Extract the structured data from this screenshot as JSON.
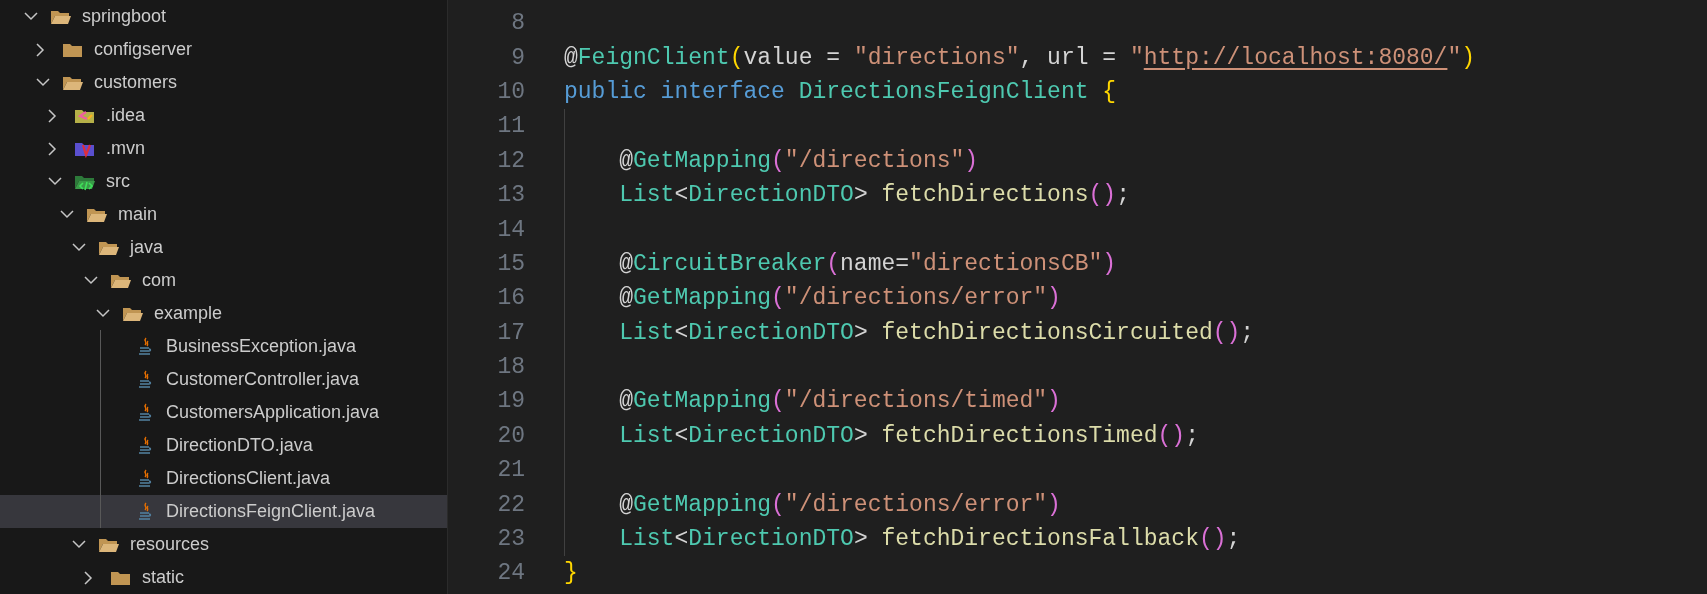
{
  "explorer": {
    "tree": [
      {
        "label": "springboot",
        "kind": "folder",
        "expanded": true,
        "selected": false,
        "children": [
          {
            "label": "configserver",
            "kind": "folder",
            "expanded": false,
            "selected": false
          },
          {
            "label": "customers",
            "kind": "folder",
            "expanded": true,
            "selected": false,
            "children": [
              {
                "label": ".idea",
                "kind": "idea",
                "expanded": false,
                "selected": false
              },
              {
                "label": ".mvn",
                "kind": "mvn",
                "expanded": false,
                "selected": false
              },
              {
                "label": "src",
                "kind": "src",
                "expanded": true,
                "selected": false,
                "children": [
                  {
                    "label": "main",
                    "kind": "folder",
                    "expanded": true,
                    "selected": false,
                    "children": [
                      {
                        "label": "java",
                        "kind": "folder",
                        "expanded": true,
                        "selected": false,
                        "children": [
                          {
                            "label": "com",
                            "kind": "folder",
                            "expanded": true,
                            "selected": false,
                            "children": [
                              {
                                "label": "example",
                                "kind": "folder",
                                "expanded": true,
                                "selected": false,
                                "children": [
                                  {
                                    "label": "BusinessException.java",
                                    "kind": "java",
                                    "selected": false
                                  },
                                  {
                                    "label": "CustomerController.java",
                                    "kind": "java",
                                    "selected": false
                                  },
                                  {
                                    "label": "CustomersApplication.java",
                                    "kind": "java",
                                    "selected": false
                                  },
                                  {
                                    "label": "DirectionDTO.java",
                                    "kind": "java",
                                    "selected": false
                                  },
                                  {
                                    "label": "DirectionsClient.java",
                                    "kind": "java",
                                    "selected": false
                                  },
                                  {
                                    "label": "DirectionsFeignClient.java",
                                    "kind": "java",
                                    "selected": true
                                  }
                                ]
                              }
                            ]
                          }
                        ]
                      },
                      {
                        "label": "resources",
                        "kind": "folder",
                        "expanded": true,
                        "selected": false,
                        "children": [
                          {
                            "label": "static",
                            "kind": "folder",
                            "expanded": false,
                            "selected": false
                          }
                        ]
                      }
                    ]
                  }
                ]
              }
            ]
          }
        ]
      }
    ]
  },
  "editor": {
    "lines": [
      {
        "number": "8"
      },
      {
        "number": "9",
        "tokens": [
          {
            "kind": "plain",
            "text": "@"
          },
          {
            "kind": "type",
            "text": "FeignClient"
          },
          {
            "kind": "bracket1",
            "text": "("
          },
          {
            "kind": "plain",
            "text": "value = "
          },
          {
            "kind": "string",
            "text": "\"directions\""
          },
          {
            "kind": "plain",
            "text": ", url = "
          },
          {
            "kind": "string",
            "text": "\""
          },
          {
            "kind": "link",
            "text": "http://localhost:8080/"
          },
          {
            "kind": "string",
            "text": "\""
          },
          {
            "kind": "bracket1",
            "text": ")"
          }
        ]
      },
      {
        "number": "10",
        "tokens": [
          {
            "kind": "keyword",
            "text": "public interface "
          },
          {
            "kind": "type",
            "text": "DirectionsFeignClient "
          },
          {
            "kind": "brace_open",
            "text": "{"
          }
        ]
      },
      {
        "number": "11"
      },
      {
        "number": "12",
        "tokens": [
          {
            "kind": "plain",
            "text": "    @"
          },
          {
            "kind": "type",
            "text": "GetMapping"
          },
          {
            "kind": "bracket2",
            "text": "("
          },
          {
            "kind": "string",
            "text": "\"/directions\""
          },
          {
            "kind": "bracket2",
            "text": ")"
          }
        ]
      },
      {
        "number": "13",
        "tokens": [
          {
            "kind": "type",
            "text": "    List"
          },
          {
            "kind": "plain",
            "text": "<"
          },
          {
            "kind": "type",
            "text": "DirectionDTO"
          },
          {
            "kind": "plain",
            "text": "> "
          },
          {
            "kind": "function",
            "text": "fetchDirections"
          },
          {
            "kind": "bracket2",
            "text": "()"
          },
          {
            "kind": "plain",
            "text": ";"
          }
        ]
      },
      {
        "number": "14"
      },
      {
        "number": "15",
        "tokens": [
          {
            "kind": "plain",
            "text": "    @"
          },
          {
            "kind": "type",
            "text": "CircuitBreaker"
          },
          {
            "kind": "bracket2",
            "text": "("
          },
          {
            "kind": "plain",
            "text": "name="
          },
          {
            "kind": "string",
            "text": "\"directionsCB\""
          },
          {
            "kind": "bracket2",
            "text": ")"
          }
        ]
      },
      {
        "number": "16",
        "tokens": [
          {
            "kind": "plain",
            "text": "    @"
          },
          {
            "kind": "type",
            "text": "GetMapping"
          },
          {
            "kind": "bracket2",
            "text": "("
          },
          {
            "kind": "string",
            "text": "\"/directions/error\""
          },
          {
            "kind": "bracket2",
            "text": ")"
          }
        ]
      },
      {
        "number": "17",
        "tokens": [
          {
            "kind": "type",
            "text": "    List"
          },
          {
            "kind": "plain",
            "text": "<"
          },
          {
            "kind": "type",
            "text": "DirectionDTO"
          },
          {
            "kind": "plain",
            "text": "> "
          },
          {
            "kind": "function",
            "text": "fetchDirectionsCircuited"
          },
          {
            "kind": "bracket2",
            "text": "()"
          },
          {
            "kind": "plain",
            "text": ";"
          }
        ]
      },
      {
        "number": "18"
      },
      {
        "number": "19",
        "tokens": [
          {
            "kind": "plain",
            "text": "    @"
          },
          {
            "kind": "type",
            "text": "GetMapping"
          },
          {
            "kind": "bracket2",
            "text": "("
          },
          {
            "kind": "string",
            "text": "\"/directions/timed\""
          },
          {
            "kind": "bracket2",
            "text": ")"
          }
        ]
      },
      {
        "number": "20",
        "tokens": [
          {
            "kind": "type",
            "text": "    List"
          },
          {
            "kind": "plain",
            "text": "<"
          },
          {
            "kind": "type",
            "text": "DirectionDTO"
          },
          {
            "kind": "plain",
            "text": "> "
          },
          {
            "kind": "function",
            "text": "fetchDirectionsTimed"
          },
          {
            "kind": "bracket2",
            "text": "()"
          },
          {
            "kind": "plain",
            "text": ";"
          }
        ]
      },
      {
        "number": "21"
      },
      {
        "number": "22",
        "tokens": [
          {
            "kind": "plain",
            "text": "    @"
          },
          {
            "kind": "type",
            "text": "GetMapping"
          },
          {
            "kind": "bracket2",
            "text": "("
          },
          {
            "kind": "string",
            "text": "\"/directions/error\""
          },
          {
            "kind": "bracket2",
            "text": ")"
          }
        ]
      },
      {
        "number": "23",
        "tokens": [
          {
            "kind": "type",
            "text": "    List"
          },
          {
            "kind": "plain",
            "text": "<"
          },
          {
            "kind": "type",
            "text": "DirectionDTO"
          },
          {
            "kind": "plain",
            "text": "> "
          },
          {
            "kind": "function",
            "text": "fetchDirectionsFallback"
          },
          {
            "kind": "bracket2",
            "text": "()"
          },
          {
            "kind": "plain",
            "text": ";"
          }
        ]
      },
      {
        "number": "24",
        "tokens": [
          {
            "kind": "brace_close",
            "text": "}"
          }
        ]
      }
    ]
  }
}
